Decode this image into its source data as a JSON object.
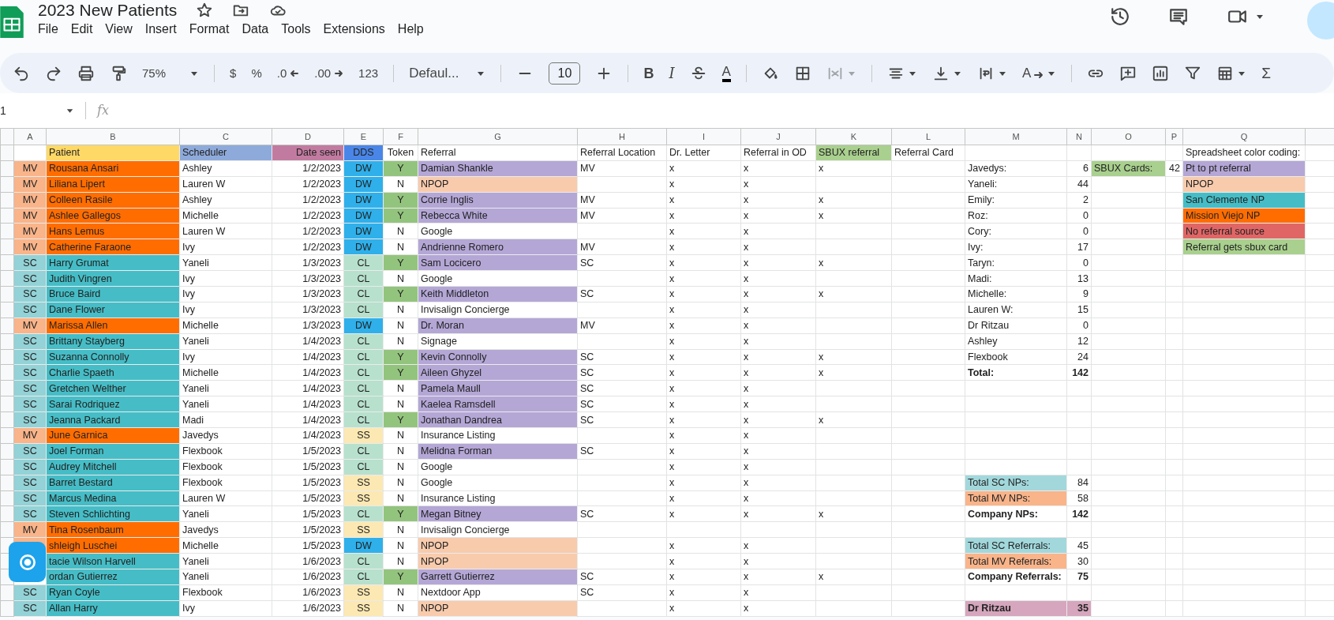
{
  "document": {
    "title": "2023 New Patients"
  },
  "menu": [
    "File",
    "Edit",
    "View",
    "Insert",
    "Format",
    "Data",
    "Tools",
    "Extensions",
    "Help"
  ],
  "toolbar": {
    "zoom": "75%",
    "currency": "$",
    "percent": "%",
    "decrease_decimals": ".0",
    "increase_decimals": ".00",
    "number_format": "123",
    "font": "Defaul...",
    "font_size": "10",
    "bold": "B",
    "italic": "I",
    "text_color": "A",
    "text_rotation": "A",
    "functions": "Σ"
  },
  "formula_bar": {
    "name_box": "1",
    "fx": "fx"
  },
  "column_letters": [
    "A",
    "B",
    "C",
    "D",
    "E",
    "F",
    "G",
    "H",
    "I",
    "J",
    "K",
    "L",
    "M",
    "N",
    "O",
    "P",
    "Q"
  ],
  "rows": [
    {
      "cells": [
        null,
        {
          "text": "Patient",
          "color": "#ffd966"
        },
        {
          "text": "Scheduler",
          "color": "#8eaadb"
        },
        {
          "text": "Date seen",
          "color": "#c27ba0"
        },
        {
          "text": "DDS",
          "color": "#4a86e8"
        },
        "Token",
        "Referral",
        "Referral Location",
        "Dr. Letter",
        "Referral in OD",
        {
          "text": "SBUX referral",
          "color": "#a9d08e"
        },
        "Referral Card",
        null,
        null,
        null,
        null,
        "Spreadsheet color coding:"
      ]
    },
    {
      "cells": [
        {
          "text": "MV",
          "color": "#f9b48a"
        },
        {
          "text": "Rousana Ansari",
          "color": "#ff6d01"
        },
        "Ashley",
        "1/2/2023",
        {
          "text": "DW",
          "color": "#2fb0ea"
        },
        {
          "text": "Y",
          "color": "#93c47d"
        },
        {
          "text": "Damian Shankle",
          "color": "#b4a7d6"
        },
        "MV",
        "x",
        "x",
        "x",
        null,
        "Javedys:",
        "6",
        {
          "text": "SBUX Cards:",
          "color": "#a9d08e"
        },
        "42",
        {
          "text": "Pt to pt referral",
          "color": "#b4a7d6"
        }
      ]
    },
    {
      "cells": [
        {
          "text": "MV",
          "color": "#f9b48a"
        },
        {
          "text": "Liliana Lipert",
          "color": "#ff6d01"
        },
        "Lauren W",
        "1/2/2023",
        {
          "text": "DW",
          "color": "#2fb0ea"
        },
        "N",
        {
          "text": "NPOP",
          "color": "#f8cbad"
        },
        null,
        "x",
        "x",
        null,
        null,
        "Yaneli:",
        "44",
        null,
        null,
        {
          "text": "NPOP",
          "color": "#f8cbad"
        }
      ]
    },
    {
      "cells": [
        {
          "text": "MV",
          "color": "#f9b48a"
        },
        {
          "text": "Colleen Rasile",
          "color": "#ff6d01"
        },
        "Ashley",
        "1/2/2023",
        {
          "text": "DW",
          "color": "#2fb0ea"
        },
        {
          "text": "Y",
          "color": "#93c47d"
        },
        {
          "text": "Corrie Inglis",
          "color": "#b4a7d6"
        },
        "MV",
        "x",
        "x",
        "x",
        null,
        "Emily:",
        "2",
        null,
        null,
        {
          "text": "San Clemente NP",
          "color": "#46bdc6"
        }
      ]
    },
    {
      "cells": [
        {
          "text": "MV",
          "color": "#f9b48a"
        },
        {
          "text": "Ashlee Gallegos",
          "color": "#ff6d01"
        },
        "Michelle",
        "1/2/2023",
        {
          "text": "DW",
          "color": "#2fb0ea"
        },
        {
          "text": "Y",
          "color": "#93c47d"
        },
        {
          "text": "Rebecca White",
          "color": "#b4a7d6"
        },
        "MV",
        "x",
        "x",
        "x",
        null,
        "Roz:",
        "0",
        null,
        null,
        {
          "text": "Mission Viejo NP",
          "color": "#ff6d01"
        }
      ]
    },
    {
      "cells": [
        {
          "text": "MV",
          "color": "#f9b48a"
        },
        {
          "text": "Hans Lemus",
          "color": "#ff6d01"
        },
        "Lauren W",
        "1/2/2023",
        {
          "text": "DW",
          "color": "#2fb0ea"
        },
        "N",
        "Google",
        null,
        "x",
        "x",
        null,
        null,
        "Cory:",
        "0",
        null,
        null,
        {
          "text": "No referral source",
          "color": "#e06666"
        }
      ]
    },
    {
      "cells": [
        {
          "text": "MV",
          "color": "#f9b48a"
        },
        {
          "text": "Catherine Faraone",
          "color": "#ff6d01"
        },
        "Ivy",
        "1/2/2023",
        {
          "text": "DW",
          "color": "#2fb0ea"
        },
        "N",
        {
          "text": "Andrienne Romero",
          "color": "#b4a7d6"
        },
        "MV",
        "x",
        "x",
        null,
        null,
        "Ivy:",
        "17",
        null,
        null,
        {
          "text": "Referral gets sbux card",
          "color": "#a9d08e"
        }
      ]
    },
    {
      "cells": [
        {
          "text": "SC",
          "color": "#93d2d6"
        },
        {
          "text": "Harry Grumat",
          "color": "#46bdc6"
        },
        "Yaneli",
        "1/3/2023",
        {
          "text": "CL",
          "color": "#b7e1cd"
        },
        {
          "text": "Y",
          "color": "#93c47d"
        },
        {
          "text": "Sam Locicero",
          "color": "#b4a7d6"
        },
        "SC",
        "x",
        "x",
        "x",
        null,
        "Taryn:",
        "0",
        null,
        null,
        null
      ]
    },
    {
      "cells": [
        {
          "text": "SC",
          "color": "#93d2d6"
        },
        {
          "text": "Judith Vingren",
          "color": "#46bdc6"
        },
        "Ivy",
        "1/3/2023",
        {
          "text": "CL",
          "color": "#b7e1cd"
        },
        "N",
        "Google",
        null,
        "x",
        "x",
        null,
        null,
        "Madi:",
        "13",
        null,
        null,
        null
      ]
    },
    {
      "cells": [
        {
          "text": "SC",
          "color": "#93d2d6"
        },
        {
          "text": "Bruce Baird",
          "color": "#46bdc6"
        },
        "Ivy",
        "1/3/2023",
        {
          "text": "CL",
          "color": "#b7e1cd"
        },
        {
          "text": "Y",
          "color": "#93c47d"
        },
        {
          "text": "Keith Middleton",
          "color": "#b4a7d6"
        },
        "SC",
        "x",
        "x",
        "x",
        null,
        "Michelle:",
        "9",
        null,
        null,
        null
      ]
    },
    {
      "cells": [
        {
          "text": "SC",
          "color": "#93d2d6"
        },
        {
          "text": "Dane Flower",
          "color": "#46bdc6"
        },
        "Ivy",
        "1/3/2023",
        {
          "text": "CL",
          "color": "#b7e1cd"
        },
        "N",
        "Invisalign Concierge",
        null,
        "x",
        "x",
        null,
        null,
        "Lauren W:",
        "15",
        null,
        null,
        null
      ]
    },
    {
      "cells": [
        {
          "text": "MV",
          "color": "#f9b48a"
        },
        {
          "text": "Marissa Allen",
          "color": "#ff6d01"
        },
        "Michelle",
        "1/3/2023",
        {
          "text": "DW",
          "color": "#2fb0ea"
        },
        "N",
        {
          "text": "Dr. Moran",
          "color": "#b4a7d6"
        },
        "MV",
        "x",
        "x",
        null,
        null,
        "Dr Ritzau",
        "0",
        null,
        null,
        null
      ]
    },
    {
      "cells": [
        {
          "text": "SC",
          "color": "#93d2d6"
        },
        {
          "text": "Brittany Stayberg",
          "color": "#46bdc6"
        },
        "Yaneli",
        "1/4/2023",
        {
          "text": "CL",
          "color": "#b7e1cd"
        },
        "N",
        "Signage",
        null,
        "x",
        "x",
        null,
        null,
        "Ashley",
        "12",
        null,
        null,
        null
      ]
    },
    {
      "cells": [
        {
          "text": "SC",
          "color": "#93d2d6"
        },
        {
          "text": "Suzanna Connolly",
          "color": "#46bdc6"
        },
        "Ivy",
        "1/4/2023",
        {
          "text": "CL",
          "color": "#b7e1cd"
        },
        {
          "text": "Y",
          "color": "#93c47d"
        },
        {
          "text": "Kevin Connolly",
          "color": "#b4a7d6"
        },
        "SC",
        "x",
        "x",
        "x",
        null,
        "Flexbook",
        "24",
        null,
        null,
        null
      ]
    },
    {
      "cells": [
        {
          "text": "SC",
          "color": "#93d2d6"
        },
        {
          "text": "Charlie Spaeth",
          "color": "#46bdc6"
        },
        "Michelle",
        "1/4/2023",
        {
          "text": "CL",
          "color": "#b7e1cd"
        },
        {
          "text": "Y",
          "color": "#93c47d"
        },
        {
          "text": "Aileen Ghyzel",
          "color": "#b4a7d6"
        },
        "SC",
        "x",
        "x",
        "x",
        null,
        {
          "text": "Total:",
          "bold": true
        },
        {
          "text": "142",
          "bold": true
        },
        null,
        null,
        null
      ]
    },
    {
      "cells": [
        {
          "text": "SC",
          "color": "#93d2d6"
        },
        {
          "text": "Gretchen Welther",
          "color": "#46bdc6"
        },
        "Yaneli",
        "1/4/2023",
        {
          "text": "CL",
          "color": "#b7e1cd"
        },
        "N",
        {
          "text": "Pamela  Maull",
          "color": "#b4a7d6"
        },
        "SC",
        "x",
        "x",
        null,
        null,
        null,
        null,
        null,
        null,
        null
      ]
    },
    {
      "cells": [
        {
          "text": "SC",
          "color": "#93d2d6"
        },
        {
          "text": "Sarai Rodriquez",
          "color": "#46bdc6"
        },
        "Yaneli",
        "1/4/2023",
        {
          "text": "CL",
          "color": "#b7e1cd"
        },
        "N",
        {
          "text": "Kaelea Ramsdell",
          "color": "#b4a7d6"
        },
        "SC",
        "x",
        "x",
        null,
        null,
        null,
        null,
        null,
        null,
        null
      ]
    },
    {
      "cells": [
        {
          "text": "SC",
          "color": "#93d2d6"
        },
        {
          "text": "Jeanna Packard",
          "color": "#46bdc6"
        },
        "Madi",
        "1/4/2023",
        {
          "text": "CL",
          "color": "#b7e1cd"
        },
        {
          "text": "Y",
          "color": "#93c47d"
        },
        {
          "text": "Jonathan Dandrea",
          "color": "#b4a7d6"
        },
        "SC",
        "x",
        "x",
        "x",
        null,
        null,
        null,
        null,
        null,
        null
      ]
    },
    {
      "cells": [
        {
          "text": "MV",
          "color": "#f9b48a"
        },
        {
          "text": "June Garnica",
          "color": "#ff6d01"
        },
        "Javedys",
        "1/4/2023",
        {
          "text": "SS",
          "color": "#fce8b2"
        },
        "N",
        "Insurance Listing",
        null,
        "x",
        "x",
        null,
        null,
        null,
        null,
        null,
        null,
        null
      ]
    },
    {
      "cells": [
        {
          "text": "SC",
          "color": "#93d2d6"
        },
        {
          "text": "Joel Forman",
          "color": "#46bdc6"
        },
        "Flexbook",
        "1/5/2023",
        {
          "text": "CL",
          "color": "#b7e1cd"
        },
        "N",
        {
          "text": "Melidna Forman",
          "color": "#b4a7d6"
        },
        "SC",
        "x",
        "x",
        null,
        null,
        null,
        null,
        null,
        null,
        null
      ]
    },
    {
      "cells": [
        {
          "text": "SC",
          "color": "#93d2d6"
        },
        {
          "text": "Audrey Mitchell",
          "color": "#46bdc6"
        },
        "Flexbook",
        "1/5/2023",
        {
          "text": "CL",
          "color": "#b7e1cd"
        },
        "N",
        "Google",
        null,
        "x",
        "x",
        null,
        null,
        null,
        null,
        null,
        null,
        null
      ]
    },
    {
      "cells": [
        {
          "text": "SC",
          "color": "#93d2d6"
        },
        {
          "text": "Barret Bestard",
          "color": "#46bdc6"
        },
        "Flexbook",
        "1/5/2023",
        {
          "text": "SS",
          "color": "#fce8b2"
        },
        "N",
        "Google",
        null,
        "x",
        "x",
        null,
        null,
        {
          "text": "Total SC NPs:",
          "color": "#a2d8dc"
        },
        "84",
        null,
        null,
        null
      ]
    },
    {
      "cells": [
        {
          "text": "SC",
          "color": "#93d2d6"
        },
        {
          "text": "Marcus Medina",
          "color": "#46bdc6"
        },
        "Lauren W",
        "1/5/2023",
        {
          "text": "SS",
          "color": "#fce8b2"
        },
        "N",
        "Insurance Listing",
        null,
        "x",
        "x",
        null,
        null,
        {
          "text": "Total MV NPs:",
          "color": "#f9b48a"
        },
        "58",
        null,
        null,
        null
      ]
    },
    {
      "cells": [
        {
          "text": "SC",
          "color": "#93d2d6"
        },
        {
          "text": "Steven Schlichting",
          "color": "#46bdc6"
        },
        "Yaneli",
        "1/5/2023",
        {
          "text": "CL",
          "color": "#b7e1cd"
        },
        {
          "text": "Y",
          "color": "#93c47d"
        },
        {
          "text": "Megan Bitney",
          "color": "#b4a7d6"
        },
        "SC",
        "x",
        "x",
        "x",
        null,
        {
          "text": "Company NPs:",
          "bold": true
        },
        {
          "text": "142",
          "bold": true
        },
        null,
        null,
        null
      ]
    },
    {
      "cells": [
        {
          "text": "MV",
          "color": "#f9b48a"
        },
        {
          "text": "Tina Rosenbaum",
          "color": "#ff6d01"
        },
        "Javedys",
        "1/5/2023",
        {
          "text": "SS",
          "color": "#fce8b2"
        },
        "N",
        "Invisalign Concierge",
        null,
        null,
        null,
        null,
        null,
        null,
        null,
        null,
        null,
        null
      ]
    },
    {
      "cells": [
        {
          "color": "#f9b48a"
        },
        {
          "text": "shleigh Luschei",
          "color": "#ff6d01"
        },
        "Michelle",
        "1/5/2023",
        {
          "text": "DW",
          "color": "#2fb0ea"
        },
        "N",
        {
          "text": "NPOP",
          "color": "#f8cbad"
        },
        null,
        "x",
        "x",
        null,
        null,
        {
          "text": "Total SC Referrals:",
          "color": "#a2d8dc"
        },
        "45",
        null,
        null,
        null
      ]
    },
    {
      "cells": [
        null,
        {
          "text": "tacie Wilson Harvell",
          "color": "#46bdc6"
        },
        "Yaneli",
        "1/6/2023",
        {
          "text": "CL",
          "color": "#b7e1cd"
        },
        "N",
        {
          "text": "NPOP",
          "color": "#f8cbad"
        },
        null,
        "x",
        "x",
        null,
        null,
        {
          "text": "Total MV Referrals:",
          "color": "#f9b48a"
        },
        "30",
        null,
        null,
        null
      ]
    },
    {
      "cells": [
        null,
        {
          "text": "ordan Gutierrez",
          "color": "#46bdc6"
        },
        "Yaneli",
        "1/6/2023",
        {
          "text": "CL",
          "color": "#b7e1cd"
        },
        {
          "text": "Y",
          "color": "#93c47d"
        },
        {
          "text": "Garrett Gutierrez",
          "color": "#b4a7d6"
        },
        "SC",
        "x",
        "x",
        "x",
        null,
        {
          "text": "Company Referrals:",
          "bold": true
        },
        {
          "text": "75",
          "bold": true
        },
        null,
        null,
        null
      ]
    },
    {
      "cells": [
        {
          "text": "SC",
          "color": "#93d2d6"
        },
        {
          "text": "Ryan Coyle",
          "color": "#46bdc6"
        },
        "Flexbook",
        "1/6/2023",
        {
          "text": "SS",
          "color": "#fce8b2"
        },
        "N",
        "Nextdoor App",
        "SC",
        "x",
        "x",
        null,
        null,
        null,
        null,
        null,
        null,
        null
      ]
    },
    {
      "cells": [
        {
          "text": "SC",
          "color": "#93d2d6"
        },
        {
          "text": "Allan Harry",
          "color": "#46bdc6"
        },
        "Ivy",
        "1/6/2023",
        {
          "text": "SS",
          "color": "#fce8b2"
        },
        "N",
        {
          "text": "NPOP",
          "color": "#f8cbad"
        },
        null,
        "x",
        "x",
        null,
        null,
        {
          "text": "Dr Ritzau",
          "color": "#d5a6bd",
          "bold": true
        },
        {
          "text": "35",
          "color": "#d5a6bd",
          "bold": true
        },
        null,
        null,
        null
      ]
    }
  ]
}
